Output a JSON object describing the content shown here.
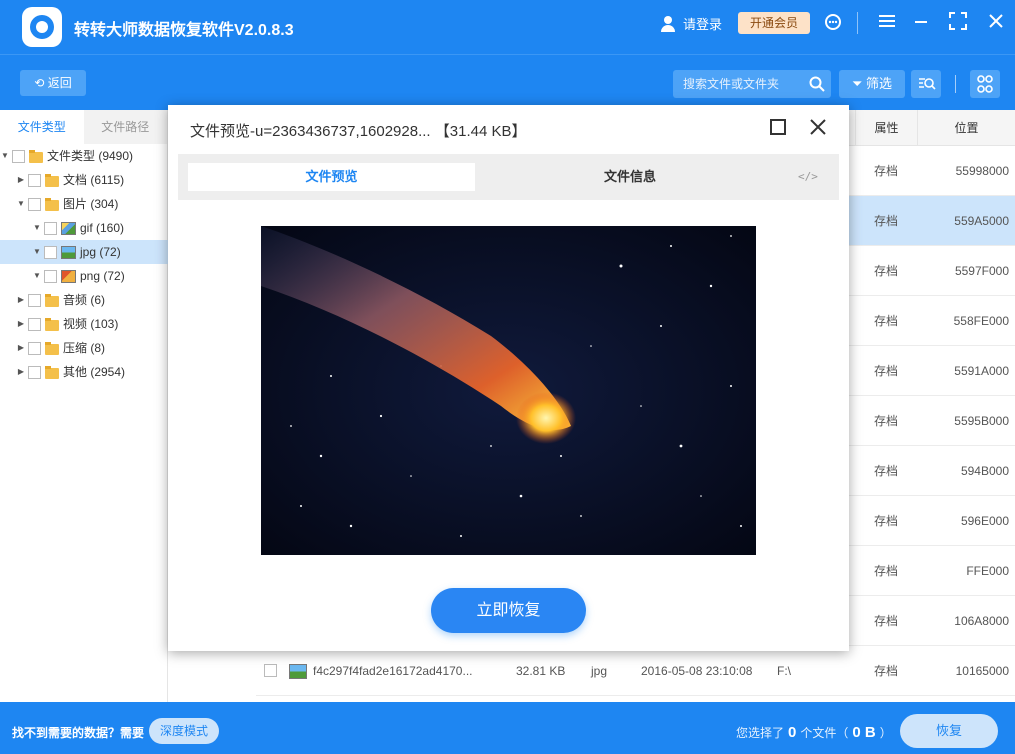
{
  "app": {
    "title": "转转大师数据恢复软件V2.0.8.3",
    "login_label": "请登录",
    "vip_label": "开通会员",
    "brand_color": "#1e86f2"
  },
  "toolbar": {
    "back_label": "返回",
    "search_placeholder": "搜索文件或文件夹",
    "filter_label": "筛选"
  },
  "sidebar": {
    "tabs": [
      "文件类型",
      "文件路径"
    ],
    "tree": [
      {
        "label": "文件类型 (9490)",
        "icon": "folder-icon"
      },
      {
        "label": "文档 (6115)",
        "icon": "folder-icon"
      },
      {
        "label": "图片 (304)",
        "icon": "folder-icon"
      },
      {
        "label": "gif (160)",
        "icon": "image-icon"
      },
      {
        "label": "jpg (72)",
        "icon": "image-icon"
      },
      {
        "label": "png (72)",
        "icon": "image-icon"
      },
      {
        "label": "音频 (6)",
        "icon": "folder-icon"
      },
      {
        "label": "视频 (103)",
        "icon": "folder-icon"
      },
      {
        "label": "压缩 (8)",
        "icon": "folder-icon"
      },
      {
        "label": "其他 (2954)",
        "icon": "folder-icon"
      }
    ]
  },
  "table": {
    "headers": [
      "属性",
      "位置"
    ],
    "rows": [
      {
        "attr": "存档",
        "pos": "55998000"
      },
      {
        "attr": "存档",
        "pos": "559A5000"
      },
      {
        "attr": "存档",
        "pos": "5597F000"
      },
      {
        "attr": "存档",
        "pos": "558FE000"
      },
      {
        "attr": "存档",
        "pos": "5591A000"
      },
      {
        "attr": "存档",
        "pos": "5595B000"
      },
      {
        "attr": "存档",
        "pos": "594B000"
      },
      {
        "attr": "存档",
        "pos": "596E000"
      },
      {
        "attr": "存档",
        "pos": "FFE000"
      },
      {
        "attr": "存档",
        "pos": "106A8000"
      }
    ],
    "last_row": {
      "name": "f4c297f4fad2e16172ad4170...",
      "size": "32.81 KB",
      "type": "jpg",
      "date": "2016-05-08 23:10:08",
      "path": "F:\\",
      "attr": "存档",
      "pos": "10165000"
    }
  },
  "modal": {
    "title": "文件预览-u=2363436737,1602928... 【31.44 KB】",
    "tab_preview": "文件预览",
    "tab_info": "文件信息",
    "code_label": "</>",
    "recover_now": "立即恢复"
  },
  "bottom": {
    "hint": "找不到需要的数据？需要",
    "deep_mode": "深度模式",
    "sel_prefix": "您选择了",
    "sel_count": "0",
    "sel_mid": "个文件（",
    "sel_size": "0 B",
    "sel_suffix": "）",
    "recover": "恢复"
  }
}
